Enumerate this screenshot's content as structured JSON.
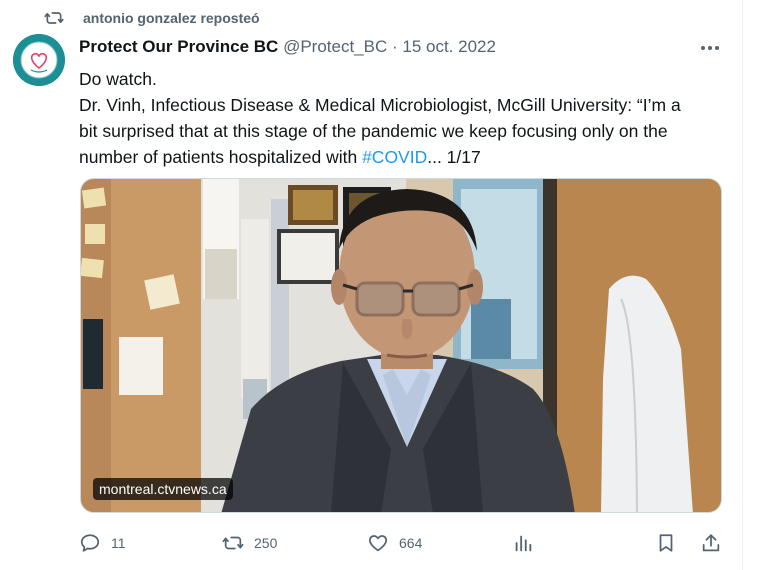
{
  "repost": {
    "icon": "repost-icon",
    "text": "antonio gonzalez reposteó"
  },
  "tweet": {
    "author_name": "Protect Our Province BC",
    "handle": "@Protect_BC",
    "separator": "·",
    "date": "15 oct. 2022",
    "more_icon": "more-horizontal-icon",
    "text_line1": "Do watch.",
    "text_line2": "Dr. Vinh, Infectious Disease & Medical Microbiologist, McGill University: “I’m a",
    "text_line3": "bit surprised that at this stage of the pandemic we keep focusing only on the",
    "text_line4_before": "number of patients hospitalized with ",
    "hashtag": "#COVID",
    "text_line4_after": "... 1/17"
  },
  "media": {
    "source": "montreal.ctvnews.ca"
  },
  "actions": {
    "reply": {
      "icon": "reply-icon",
      "count": "11"
    },
    "repost": {
      "icon": "repost-icon",
      "count": "250"
    },
    "like": {
      "icon": "heart-icon",
      "count": "664"
    },
    "views": {
      "icon": "views-chart-icon"
    },
    "bookmark": {
      "icon": "bookmark-icon"
    },
    "share": {
      "icon": "share-icon"
    }
  },
  "colors": {
    "text": "#0f1419",
    "secondary": "#536471",
    "link": "#1d9bf0",
    "avatar": "#1d8f94"
  }
}
